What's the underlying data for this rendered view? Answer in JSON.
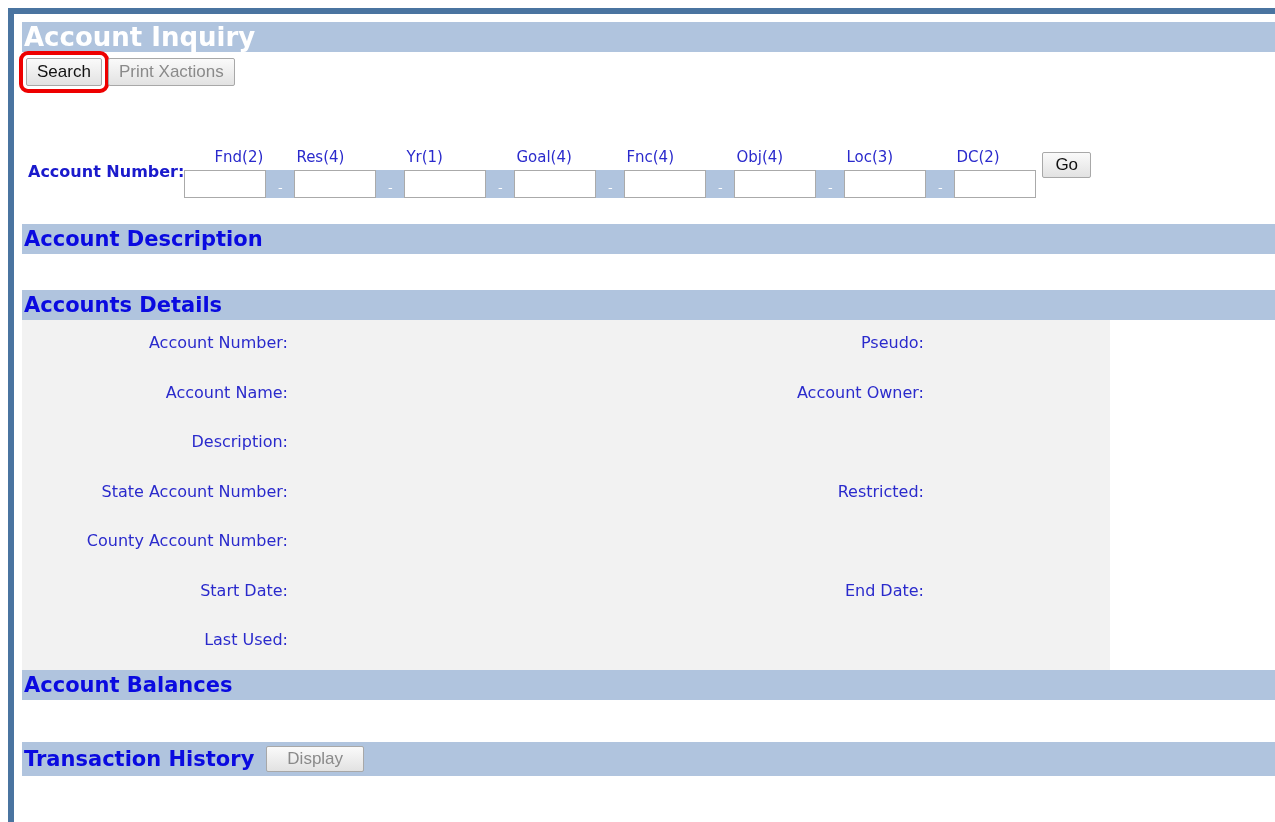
{
  "title": "Account Inquiry",
  "toolbar": [
    {
      "label": "Search",
      "disabled": false,
      "highlighted": true
    },
    {
      "label": "Print Xactions",
      "disabled": true,
      "highlighted": false
    }
  ],
  "account_number": {
    "label": "Account Number:",
    "segments": [
      {
        "label": "Fnd(2)"
      },
      {
        "label": "Res(4)",
        "separator": "-"
      },
      {
        "label": "Yr(1)",
        "separator": "-"
      },
      {
        "label": "Goal(4)",
        "separator": "-"
      },
      {
        "label": "Fnc(4)",
        "separator": "-"
      },
      {
        "label": "Obj(4)",
        "separator": "-"
      },
      {
        "label": "Loc(3)",
        "separator": "-"
      },
      {
        "label": "DC(2)",
        "separator": "-"
      }
    ],
    "go_button": "Go"
  },
  "account_description": {
    "title": "Account Description"
  },
  "accounts_details": {
    "title": "Accounts Details",
    "rows": [
      {
        "left": "Account Number:",
        "right": "Pseudo:"
      },
      {
        "left": "Account Name:",
        "right": "Account Owner:"
      },
      {
        "left": "Description:"
      },
      {
        "left": "State Account Number:",
        "right": "Restricted:"
      },
      {
        "left": "County Account Number:"
      },
      {
        "left": "Start Date:",
        "right": "End Date:"
      },
      {
        "left": "Last Used:"
      }
    ]
  },
  "account_balances": {
    "title": "Account Balances"
  },
  "transaction_history": {
    "title": "Transaction History",
    "button": {
      "label": "Display",
      "disabled": true
    }
  }
}
